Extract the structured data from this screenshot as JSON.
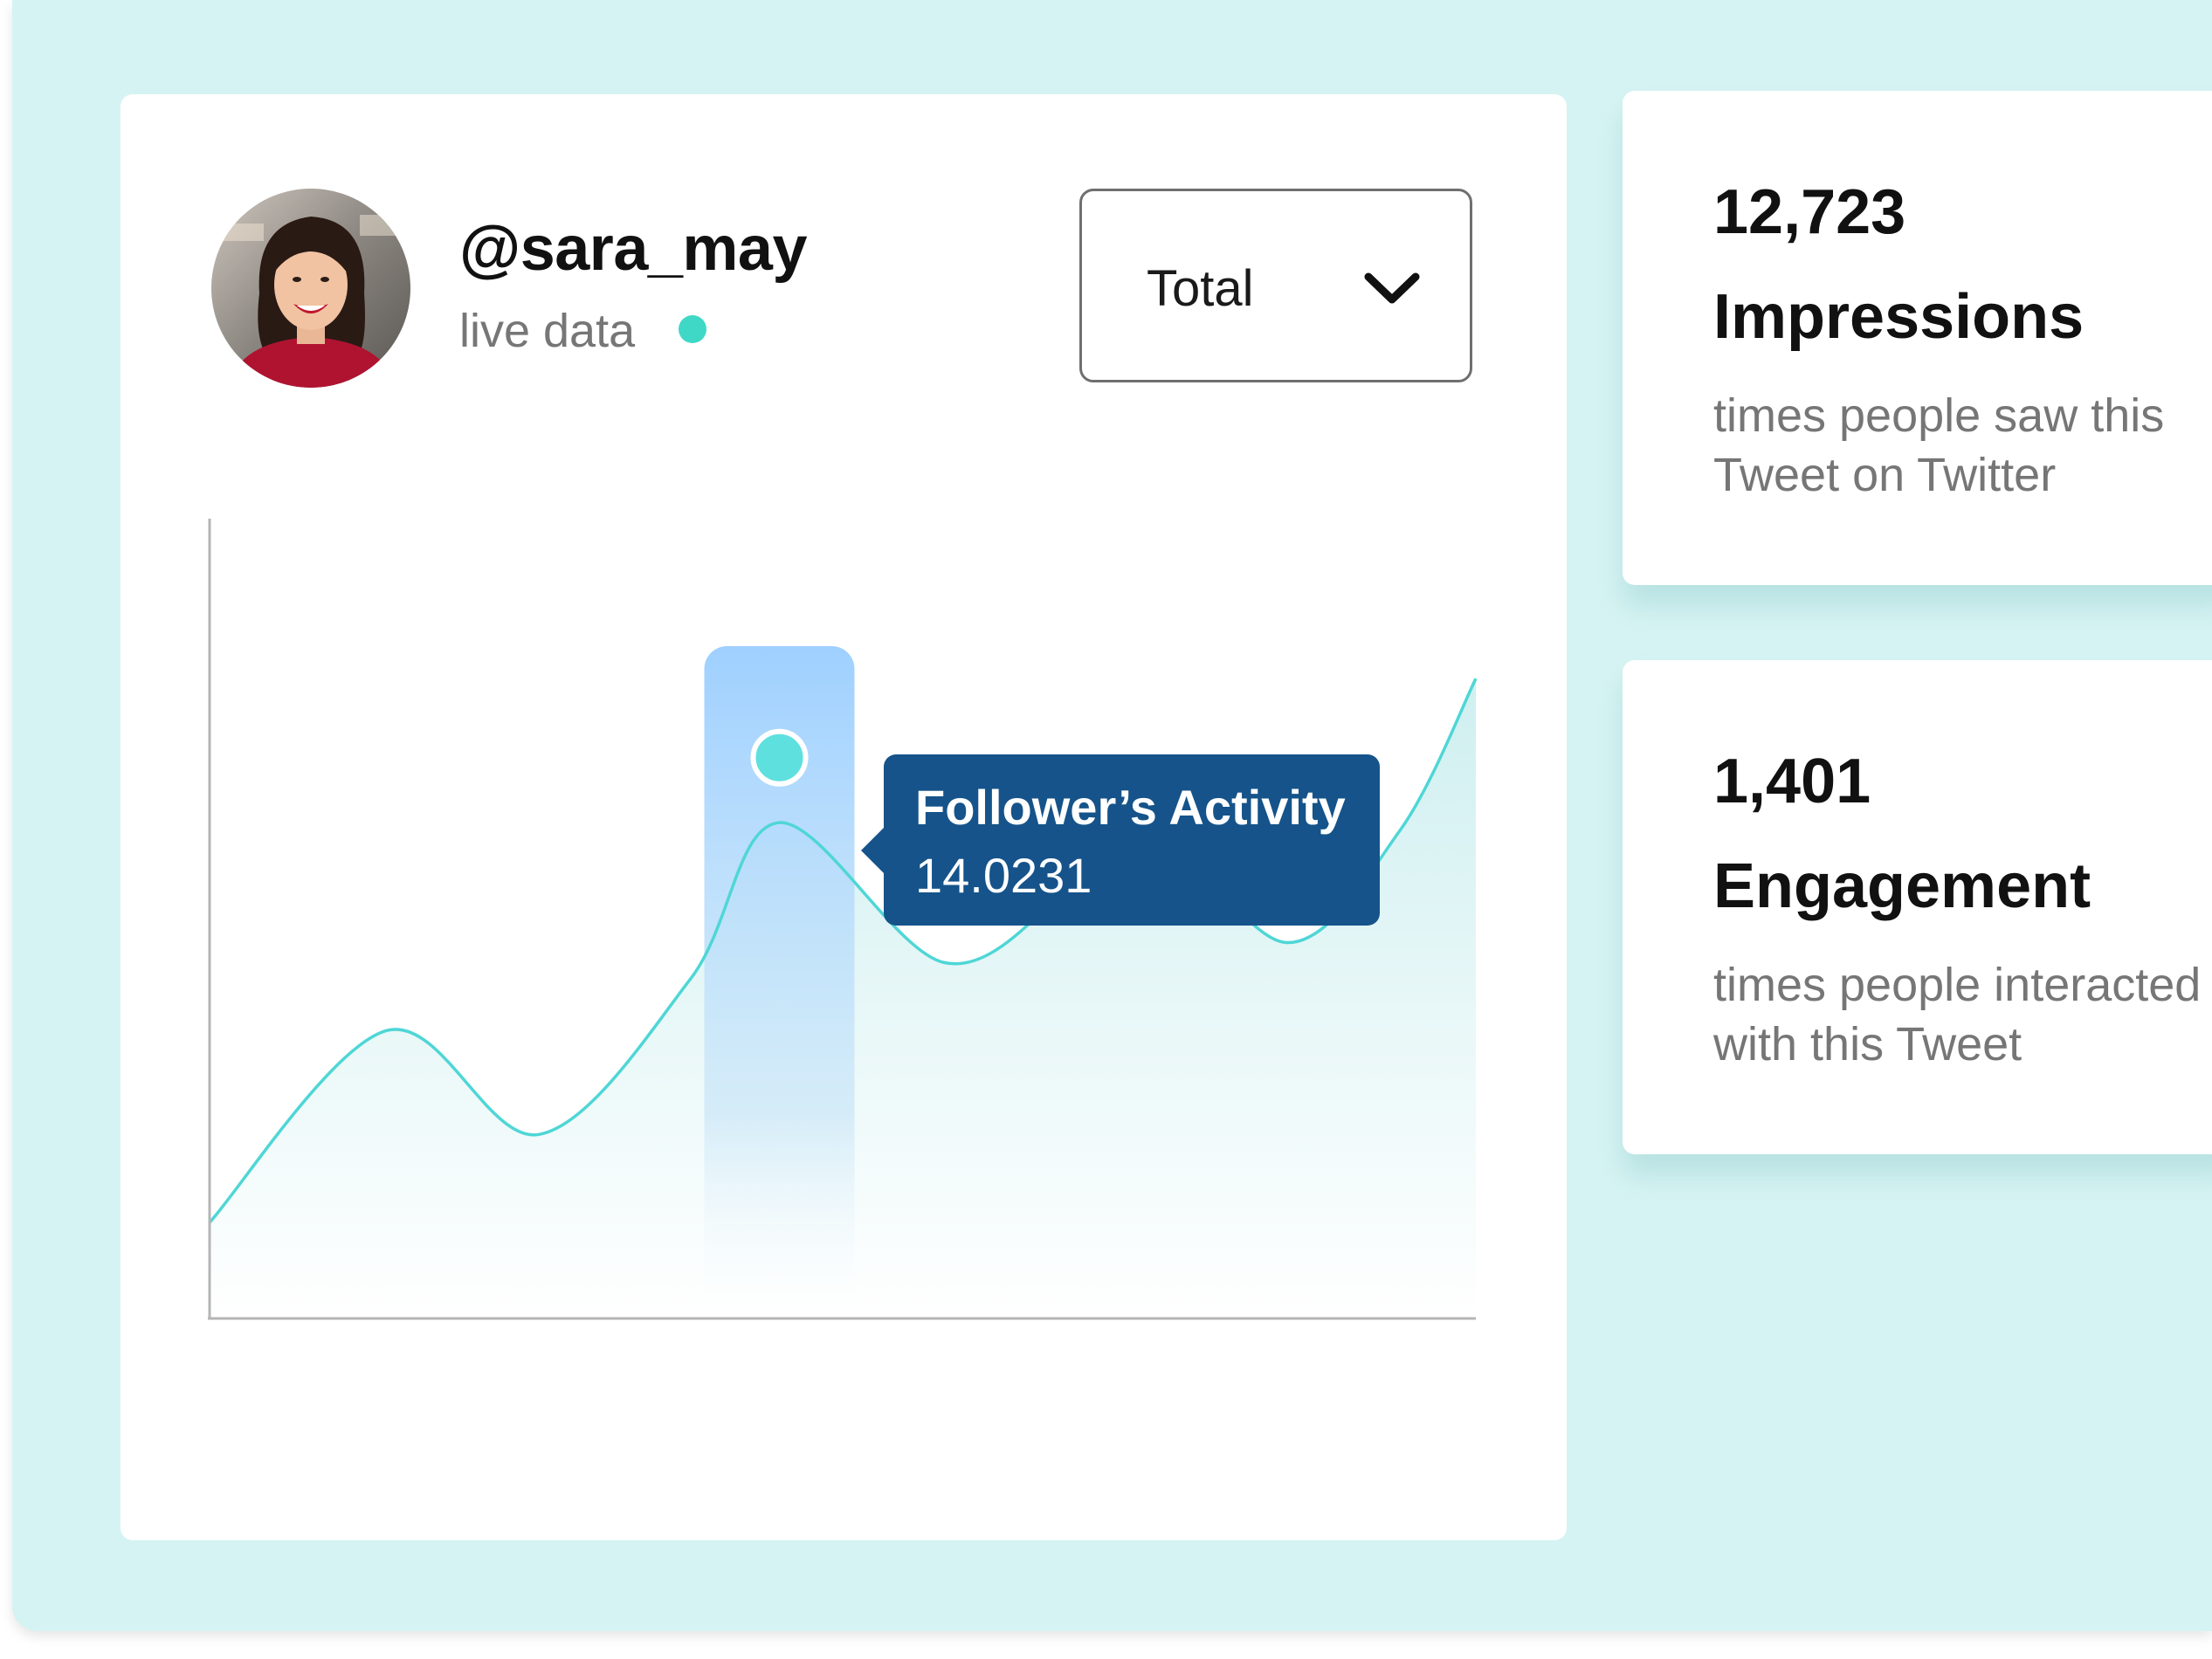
{
  "profile": {
    "username": "@sara_may",
    "status_text": "live data",
    "status_color": "#3fd8c6"
  },
  "filter": {
    "selected": "Total",
    "icon": "chevron-down-icon"
  },
  "tooltip": {
    "title": "Follower’s Activity",
    "value": "14.0231"
  },
  "stats": [
    {
      "value": "12,723",
      "label": "Impressions",
      "description_line1": "times people saw this",
      "description_line2": "Tweet on Twitter"
    },
    {
      "value": "1,401",
      "label": "Engagement",
      "description_line1": "times people interacted",
      "description_line2": "with this Tweet"
    }
  ],
  "colors": {
    "background": "#d6f3f3",
    "line": "#4fd6d6",
    "highlight_bar": "#9fd0ff",
    "tooltip": "#15538a",
    "point": "#5ee0de"
  },
  "chart_data": {
    "type": "area",
    "grid": false,
    "xlim": [
      0,
      100
    ],
    "ylim": [
      0,
      20
    ],
    "x": [
      0,
      14,
      26,
      38,
      45,
      58,
      68,
      74,
      85,
      94,
      100
    ],
    "y": [
      2.4,
      7.2,
      4.6,
      8.5,
      12.4,
      8.9,
      10.8,
      12.6,
      9.4,
      12.2,
      16.0
    ],
    "highlight": {
      "x": 45,
      "y": 14.0231
    }
  }
}
